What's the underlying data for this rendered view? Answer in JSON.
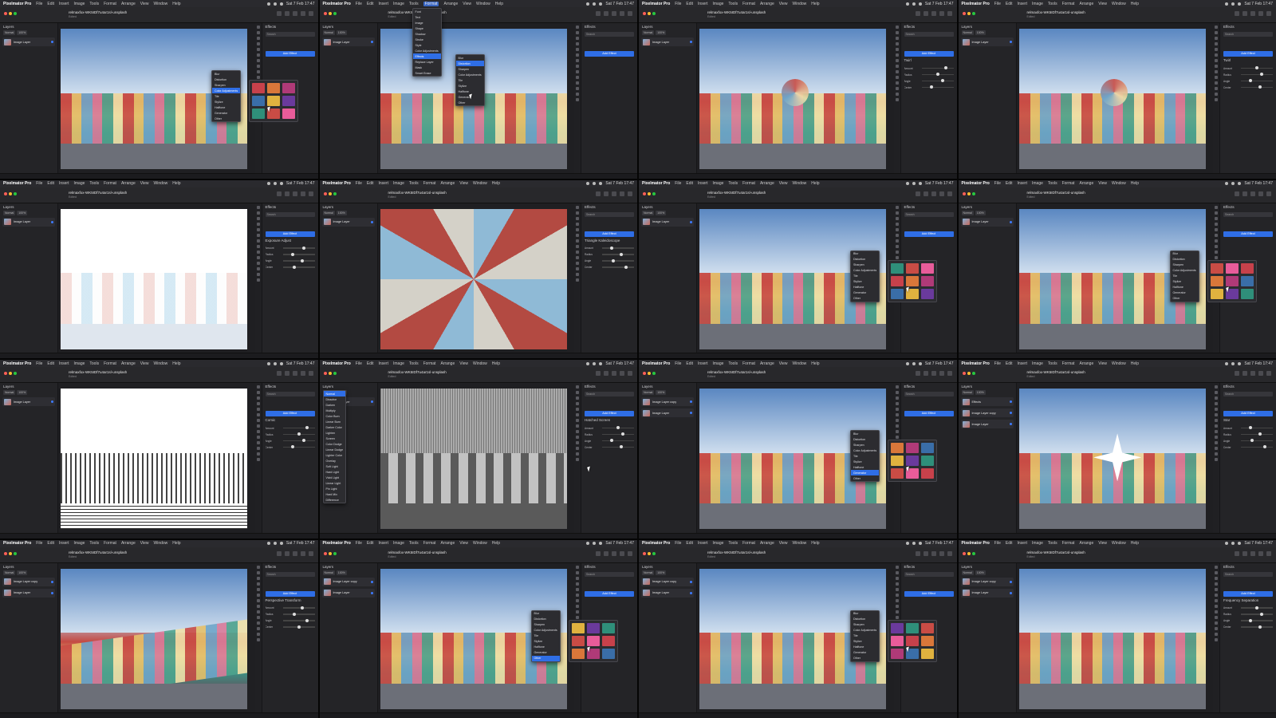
{
  "app": {
    "name": "Pixelmator Pro",
    "menu": [
      "File",
      "Edit",
      "Insert",
      "Image",
      "Tools",
      "Format",
      "Arrange",
      "View",
      "Window",
      "Help"
    ],
    "clock": "Sat 7 Feb 17:47",
    "document_title": "relmaxfox-WK5IDf7u4ar1sl-unsplash",
    "document_sub": "Edited",
    "layers_title": "Layers",
    "effects_title": "Effects",
    "add_effect": "Add Effect",
    "blend_mode": "Normal",
    "opacity": "100%",
    "search_placeholder": "Search"
  },
  "colors": {
    "accent": "#2f6ee6",
    "menubar": "#2a2a2e",
    "panel": "#242427"
  },
  "tiles": [
    {
      "canvas": "photo",
      "overlay": "effects-menu-presets",
      "layers": [
        "Image Layer"
      ],
      "effect": "",
      "highlight": "Color Adjustments"
    },
    {
      "canvas": "photo",
      "overlay": "format-menu",
      "layers": [
        "Image Layer"
      ],
      "effect": "",
      "highlight": "Effects"
    },
    {
      "canvas": "photo-swirl",
      "overlay": "",
      "layers": [
        "Image Layer"
      ],
      "effect": "Twirl",
      "highlight": ""
    },
    {
      "canvas": "photo-swirl",
      "overlay": "",
      "layers": [
        "Image Layer"
      ],
      "effect": "Twirl",
      "highlight": ""
    },
    {
      "canvas": "white",
      "overlay": "",
      "layers": [
        "Image Layer"
      ],
      "effect": "Exposure Adjust",
      "highlight": ""
    },
    {
      "canvas": "kaleido",
      "overlay": "",
      "layers": [
        "Image Layer"
      ],
      "effect": "Triangle Kaleidoscope",
      "highlight": ""
    },
    {
      "canvas": "photo",
      "overlay": "effects-menu-presets",
      "layers": [
        "Image Layer"
      ],
      "effect": "",
      "highlight": "Style"
    },
    {
      "canvas": "photo",
      "overlay": "effects-menu-presets",
      "layers": [
        "Image Layer"
      ],
      "effect": "",
      "highlight": "Style"
    },
    {
      "canvas": "bw",
      "overlay": "",
      "layers": [
        "Image Layer"
      ],
      "effect": "Comic",
      "highlight": ""
    },
    {
      "canvas": "gray",
      "overlay": "blend-list",
      "layers": [
        "Image Layer"
      ],
      "effect": "Hatched Screen",
      "highlight": "Normal"
    },
    {
      "canvas": "photo",
      "overlay": "effects-menu-presets",
      "layers": [
        "Image Layer copy",
        "Image Layer"
      ],
      "effect": "",
      "highlight": "Generator"
    },
    {
      "canvas": "photo-star",
      "overlay": "",
      "layers": [
        "Effects",
        "Image Layer copy",
        "Image Layer"
      ],
      "effect": "Star",
      "highlight": ""
    },
    {
      "canvas": "photo-skew",
      "overlay": "",
      "layers": [
        "Image Layer copy",
        "Image Layer"
      ],
      "effect": "Perspective Transform",
      "highlight": ""
    },
    {
      "canvas": "photo",
      "overlay": "effects-menu-presets",
      "layers": [
        "Image Layer copy",
        "Image Layer"
      ],
      "effect": "",
      "highlight": "Other"
    },
    {
      "canvas": "photo",
      "overlay": "effects-menu-presets",
      "layers": [
        "Image Layer copy",
        "Image Layer"
      ],
      "effect": "",
      "highlight": "Style"
    },
    {
      "canvas": "photo",
      "overlay": "",
      "layers": [
        "Image Layer copy",
        "Image Layer"
      ],
      "effect": "Frequency Separation",
      "highlight": ""
    }
  ],
  "effects_menu": [
    "Blur",
    "Distortion",
    "Sharpen",
    "Color Adjustments",
    "Tile",
    "Stylize",
    "Halftone",
    "Generator",
    "Other"
  ],
  "format_menu": [
    "Font",
    "Text",
    "Image",
    "Shape",
    "Shadow",
    "Stroke",
    "Style",
    "Color Adjustments",
    "Effects",
    "Replace Layer",
    "Mask",
    "Smart Erase"
  ],
  "blend_list": [
    "Normal",
    "Dissolve",
    "Darken",
    "Multiply",
    "Color Burn",
    "Linear Burn",
    "Darker Color",
    "Lighten",
    "Screen",
    "Color Dodge",
    "Linear Dodge",
    "Lighter Color",
    "Overlay",
    "Soft Light",
    "Hard Light",
    "Vivid Light",
    "Linear Light",
    "Pin Light",
    "Hard Mix",
    "Difference",
    "Exclusion",
    "Subtract",
    "Divide",
    "Hue",
    "Saturation",
    "Color",
    "Luminosity"
  ],
  "param_labels": [
    "Amount",
    "Radius",
    "Angle",
    "Center",
    "Strength",
    "Intensity"
  ]
}
